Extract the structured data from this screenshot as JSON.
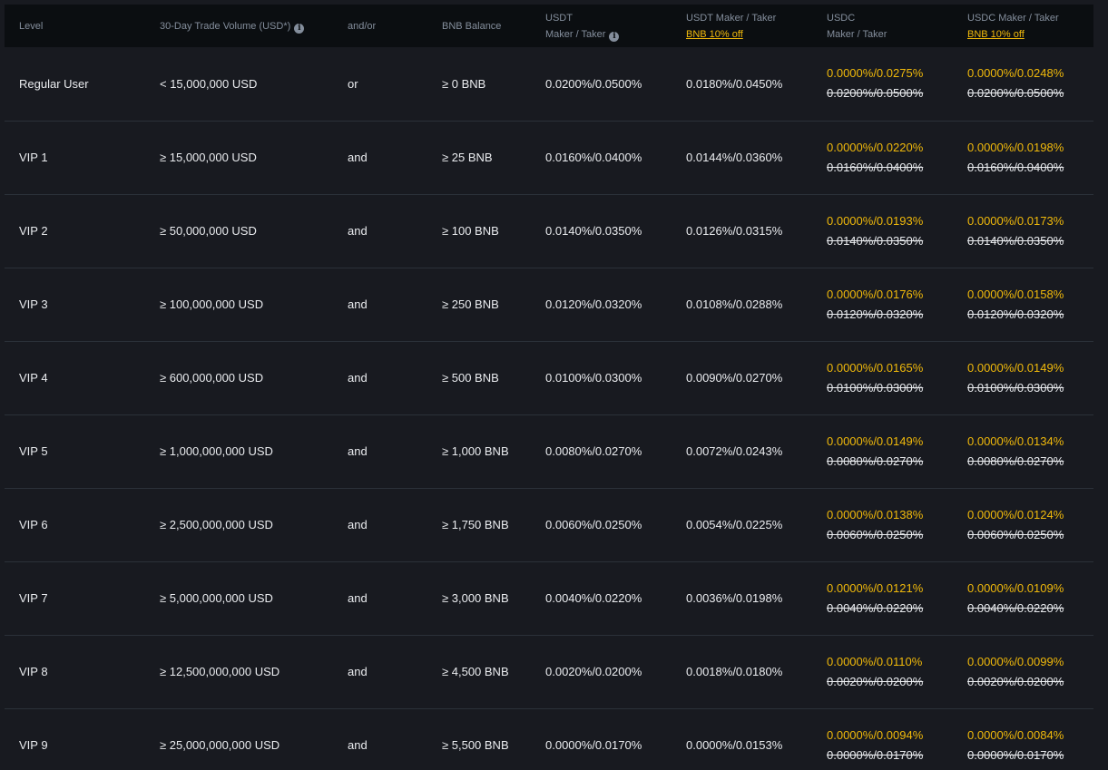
{
  "header": {
    "level": "Level",
    "volume": "30-Day Trade Volume (USD*)",
    "andor": "and/or",
    "bnb_balance": "BNB Balance",
    "usdt_line1": "USDT",
    "usdt_line2": "Maker / Taker",
    "usdt_bnb_line1": "USDT Maker / Taker",
    "usdt_bnb_line2": "BNB 10% off",
    "usdc_line1": "USDC",
    "usdc_line2": "Maker / Taker",
    "usdc_bnb_line1": "USDC Maker / Taker",
    "usdc_bnb_line2": "BNB 10% off",
    "info_icon": "i"
  },
  "rows": [
    {
      "level": "Regular User",
      "volume": "< 15,000,000 USD",
      "andor": "or",
      "bnb": "≥ 0 BNB",
      "usdt": "0.0200%/0.0500%",
      "usdt_bnb": "0.0180%/0.0450%",
      "usdc_disc": "0.0000%/0.0275%",
      "usdc_orig": "0.0200%/0.0500%",
      "usdc_bnb_disc": "0.0000%/0.0248%",
      "usdc_bnb_orig": "0.0200%/0.0500%"
    },
    {
      "level": "VIP 1",
      "volume": "≥ 15,000,000 USD",
      "andor": "and",
      "bnb": "≥ 25 BNB",
      "usdt": "0.0160%/0.0400%",
      "usdt_bnb": "0.0144%/0.0360%",
      "usdc_disc": "0.0000%/0.0220%",
      "usdc_orig": "0.0160%/0.0400%",
      "usdc_bnb_disc": "0.0000%/0.0198%",
      "usdc_bnb_orig": "0.0160%/0.0400%"
    },
    {
      "level": "VIP 2",
      "volume": "≥ 50,000,000 USD",
      "andor": "and",
      "bnb": "≥ 100 BNB",
      "usdt": "0.0140%/0.0350%",
      "usdt_bnb": "0.0126%/0.0315%",
      "usdc_disc": "0.0000%/0.0193%",
      "usdc_orig": "0.0140%/0.0350%",
      "usdc_bnb_disc": "0.0000%/0.0173%",
      "usdc_bnb_orig": "0.0140%/0.0350%"
    },
    {
      "level": "VIP 3",
      "volume": "≥ 100,000,000 USD",
      "andor": "and",
      "bnb": "≥ 250 BNB",
      "usdt": "0.0120%/0.0320%",
      "usdt_bnb": "0.0108%/0.0288%",
      "usdc_disc": "0.0000%/0.0176%",
      "usdc_orig": "0.0120%/0.0320%",
      "usdc_bnb_disc": "0.0000%/0.0158%",
      "usdc_bnb_orig": "0.0120%/0.0320%"
    },
    {
      "level": "VIP 4",
      "volume": "≥ 600,000,000 USD",
      "andor": "and",
      "bnb": "≥ 500 BNB",
      "usdt": "0.0100%/0.0300%",
      "usdt_bnb": "0.0090%/0.0270%",
      "usdc_disc": "0.0000%/0.0165%",
      "usdc_orig": "0.0100%/0.0300%",
      "usdc_bnb_disc": "0.0000%/0.0149%",
      "usdc_bnb_orig": "0.0100%/0.0300%"
    },
    {
      "level": "VIP 5",
      "volume": "≥ 1,000,000,000 USD",
      "andor": "and",
      "bnb": "≥ 1,000 BNB",
      "usdt": "0.0080%/0.0270%",
      "usdt_bnb": "0.0072%/0.0243%",
      "usdc_disc": "0.0000%/0.0149%",
      "usdc_orig": "0.0080%/0.0270%",
      "usdc_bnb_disc": "0.0000%/0.0134%",
      "usdc_bnb_orig": "0.0080%/0.0270%"
    },
    {
      "level": "VIP 6",
      "volume": "≥ 2,500,000,000 USD",
      "andor": "and",
      "bnb": "≥ 1,750 BNB",
      "usdt": "0.0060%/0.0250%",
      "usdt_bnb": "0.0054%/0.0225%",
      "usdc_disc": "0.0000%/0.0138%",
      "usdc_orig": "0.0060%/0.0250%",
      "usdc_bnb_disc": "0.0000%/0.0124%",
      "usdc_bnb_orig": "0.0060%/0.0250%"
    },
    {
      "level": "VIP 7",
      "volume": "≥ 5,000,000,000 USD",
      "andor": "and",
      "bnb": "≥ 3,000 BNB",
      "usdt": "0.0040%/0.0220%",
      "usdt_bnb": "0.0036%/0.0198%",
      "usdc_disc": "0.0000%/0.0121%",
      "usdc_orig": "0.0040%/0.0220%",
      "usdc_bnb_disc": "0.0000%/0.0109%",
      "usdc_bnb_orig": "0.0040%/0.0220%"
    },
    {
      "level": "VIP 8",
      "volume": "≥ 12,500,000,000 USD",
      "andor": "and",
      "bnb": "≥ 4,500 BNB",
      "usdt": "0.0020%/0.0200%",
      "usdt_bnb": "0.0018%/0.0180%",
      "usdc_disc": "0.0000%/0.0110%",
      "usdc_orig": "0.0020%/0.0200%",
      "usdc_bnb_disc": "0.0000%/0.0099%",
      "usdc_bnb_orig": "0.0020%/0.0200%"
    },
    {
      "level": "VIP 9",
      "volume": "≥ 25,000,000,000 USD",
      "andor": "and",
      "bnb": "≥ 5,500 BNB",
      "usdt": "0.0000%/0.0170%",
      "usdt_bnb": "0.0000%/0.0153%",
      "usdc_disc": "0.0000%/0.0094%",
      "usdc_orig": "0.0000%/0.0170%",
      "usdc_bnb_disc": "0.0000%/0.0084%",
      "usdc_bnb_orig": "0.0000%/0.0170%"
    }
  ],
  "colors": {
    "background": "#181a20",
    "header_bg": "#0b0e11",
    "accent": "#f0b90b",
    "text": "#eaecef",
    "muted": "#848e9c",
    "divider": "#2b3139"
  }
}
